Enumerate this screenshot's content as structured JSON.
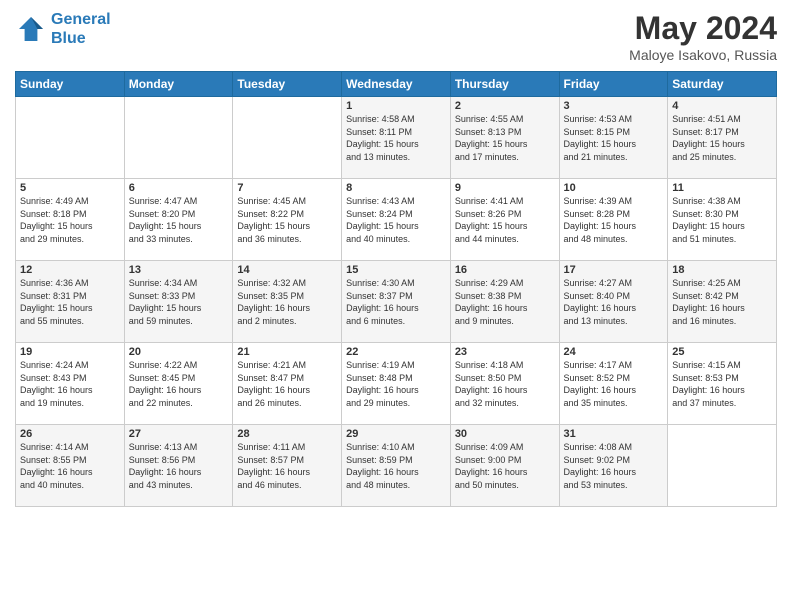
{
  "header": {
    "logo_line1": "General",
    "logo_line2": "Blue",
    "title": "May 2024",
    "subtitle": "Maloye Isakovo, Russia"
  },
  "days_of_week": [
    "Sunday",
    "Monday",
    "Tuesday",
    "Wednesday",
    "Thursday",
    "Friday",
    "Saturday"
  ],
  "weeks": [
    [
      {
        "day": "",
        "info": ""
      },
      {
        "day": "",
        "info": ""
      },
      {
        "day": "",
        "info": ""
      },
      {
        "day": "1",
        "info": "Sunrise: 4:58 AM\nSunset: 8:11 PM\nDaylight: 15 hours\nand 13 minutes."
      },
      {
        "day": "2",
        "info": "Sunrise: 4:55 AM\nSunset: 8:13 PM\nDaylight: 15 hours\nand 17 minutes."
      },
      {
        "day": "3",
        "info": "Sunrise: 4:53 AM\nSunset: 8:15 PM\nDaylight: 15 hours\nand 21 minutes."
      },
      {
        "day": "4",
        "info": "Sunrise: 4:51 AM\nSunset: 8:17 PM\nDaylight: 15 hours\nand 25 minutes."
      }
    ],
    [
      {
        "day": "5",
        "info": "Sunrise: 4:49 AM\nSunset: 8:18 PM\nDaylight: 15 hours\nand 29 minutes."
      },
      {
        "day": "6",
        "info": "Sunrise: 4:47 AM\nSunset: 8:20 PM\nDaylight: 15 hours\nand 33 minutes."
      },
      {
        "day": "7",
        "info": "Sunrise: 4:45 AM\nSunset: 8:22 PM\nDaylight: 15 hours\nand 36 minutes."
      },
      {
        "day": "8",
        "info": "Sunrise: 4:43 AM\nSunset: 8:24 PM\nDaylight: 15 hours\nand 40 minutes."
      },
      {
        "day": "9",
        "info": "Sunrise: 4:41 AM\nSunset: 8:26 PM\nDaylight: 15 hours\nand 44 minutes."
      },
      {
        "day": "10",
        "info": "Sunrise: 4:39 AM\nSunset: 8:28 PM\nDaylight: 15 hours\nand 48 minutes."
      },
      {
        "day": "11",
        "info": "Sunrise: 4:38 AM\nSunset: 8:30 PM\nDaylight: 15 hours\nand 51 minutes."
      }
    ],
    [
      {
        "day": "12",
        "info": "Sunrise: 4:36 AM\nSunset: 8:31 PM\nDaylight: 15 hours\nand 55 minutes."
      },
      {
        "day": "13",
        "info": "Sunrise: 4:34 AM\nSunset: 8:33 PM\nDaylight: 15 hours\nand 59 minutes."
      },
      {
        "day": "14",
        "info": "Sunrise: 4:32 AM\nSunset: 8:35 PM\nDaylight: 16 hours\nand 2 minutes."
      },
      {
        "day": "15",
        "info": "Sunrise: 4:30 AM\nSunset: 8:37 PM\nDaylight: 16 hours\nand 6 minutes."
      },
      {
        "day": "16",
        "info": "Sunrise: 4:29 AM\nSunset: 8:38 PM\nDaylight: 16 hours\nand 9 minutes."
      },
      {
        "day": "17",
        "info": "Sunrise: 4:27 AM\nSunset: 8:40 PM\nDaylight: 16 hours\nand 13 minutes."
      },
      {
        "day": "18",
        "info": "Sunrise: 4:25 AM\nSunset: 8:42 PM\nDaylight: 16 hours\nand 16 minutes."
      }
    ],
    [
      {
        "day": "19",
        "info": "Sunrise: 4:24 AM\nSunset: 8:43 PM\nDaylight: 16 hours\nand 19 minutes."
      },
      {
        "day": "20",
        "info": "Sunrise: 4:22 AM\nSunset: 8:45 PM\nDaylight: 16 hours\nand 22 minutes."
      },
      {
        "day": "21",
        "info": "Sunrise: 4:21 AM\nSunset: 8:47 PM\nDaylight: 16 hours\nand 26 minutes."
      },
      {
        "day": "22",
        "info": "Sunrise: 4:19 AM\nSunset: 8:48 PM\nDaylight: 16 hours\nand 29 minutes."
      },
      {
        "day": "23",
        "info": "Sunrise: 4:18 AM\nSunset: 8:50 PM\nDaylight: 16 hours\nand 32 minutes."
      },
      {
        "day": "24",
        "info": "Sunrise: 4:17 AM\nSunset: 8:52 PM\nDaylight: 16 hours\nand 35 minutes."
      },
      {
        "day": "25",
        "info": "Sunrise: 4:15 AM\nSunset: 8:53 PM\nDaylight: 16 hours\nand 37 minutes."
      }
    ],
    [
      {
        "day": "26",
        "info": "Sunrise: 4:14 AM\nSunset: 8:55 PM\nDaylight: 16 hours\nand 40 minutes."
      },
      {
        "day": "27",
        "info": "Sunrise: 4:13 AM\nSunset: 8:56 PM\nDaylight: 16 hours\nand 43 minutes."
      },
      {
        "day": "28",
        "info": "Sunrise: 4:11 AM\nSunset: 8:57 PM\nDaylight: 16 hours\nand 46 minutes."
      },
      {
        "day": "29",
        "info": "Sunrise: 4:10 AM\nSunset: 8:59 PM\nDaylight: 16 hours\nand 48 minutes."
      },
      {
        "day": "30",
        "info": "Sunrise: 4:09 AM\nSunset: 9:00 PM\nDaylight: 16 hours\nand 50 minutes."
      },
      {
        "day": "31",
        "info": "Sunrise: 4:08 AM\nSunset: 9:02 PM\nDaylight: 16 hours\nand 53 minutes."
      },
      {
        "day": "",
        "info": ""
      }
    ]
  ]
}
